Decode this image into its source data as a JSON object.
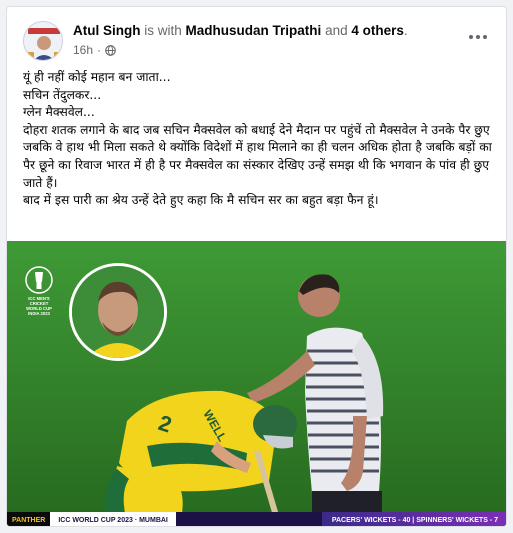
{
  "post": {
    "author": "Atul Singh",
    "with_text": "is with",
    "tagged": "Madhusudan Tripathi",
    "and_text": "and",
    "others": "4 others",
    "trailing": ".",
    "time": "16h",
    "dot": "·",
    "audience_icon": "globe-icon",
    "lines": [
      "यूं ही नहीं कोई महान बन जाता...",
      "सचिन तेंदुलकर...",
      "ग्लेन मैक्सवेल...",
      "दोहरा शतक लगाने के बाद जब सचिन मैक्सवेल को बधाई देने मैदान पर पहुंचें तो मैक्सवेल ने उनके पैर छुए जबकि वे हाथ भी मिला सकते थे क्योंकि विदेशों में हाथ मिलाने का ही चलन अधिक होता है जबकि बड़ों का पैर छूने का रिवाज भारत में ही है पर मैक्सवेल का संस्कार देखिए उन्हें समझ थी कि भगवान के पांव ही छुए जाते हैं।",
      "बाद में इस पारी का श्रेय उन्हें देते हुए कहा कि मै सचिन सर का बहुत बड़ा फैन हूं।"
    ]
  },
  "photo": {
    "logo_lines": [
      "ICC MEN'S",
      "CRICKET",
      "WORLD CUP",
      "INDIA 2023"
    ],
    "jersey_text": "2  WELL",
    "scorebar": {
      "brand": "PANTHER",
      "event": "ICC WORLD CUP 2023 · MUMBAI",
      "stats": "PACERS' WICKETS - 40 | SPINNERS' WICKETS - 7"
    }
  },
  "colors": {
    "field_green": "#2f7d2a",
    "jersey_yellow": "#f2d41c",
    "scorebar_purple": "#1c1246"
  }
}
